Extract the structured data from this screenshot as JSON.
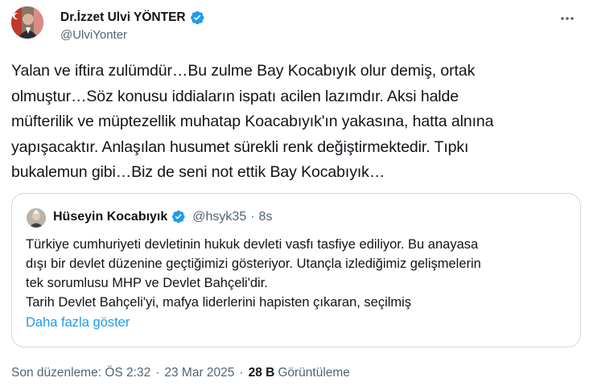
{
  "author": {
    "display_name": "Dr.İzzet Ulvi YÖNTER",
    "handle": "@UlviYonter",
    "verified": true,
    "avatar_icon": "avatar-photo"
  },
  "tweet": {
    "text": "Yalan ve iftira zulümdür…Bu zulme Bay Kocabıyık olur demiş, ortak\nolmuştur…Söz konusu iddiaların ispatı acilen lazımdır. Aksi halde\nmüfterilik ve müptezellik muhatap Koacabıyık'ın yakasına, hatta alnına\nyapışacaktır. Anlaşılan husumet sürekli renk değiştirmektedir. Tıpkı\nbukalemun gibi…Biz de seni not ettik Bay Kocabıyık…"
  },
  "quote": {
    "display_name": "Hüseyin Kocabıyık",
    "handle": "@hsyk35",
    "separator": "·",
    "time": "8s",
    "text": "Türkiye cumhuriyeti devletinin hukuk devleti vasfı tasfiye ediliyor. Bu anayasa\ndışı bir devlet düzenine geçtiğimizi gösteriyor. Utançla izlediğimiz gelişmelerin\ntek sorumlusu MHP ve Devlet Bahçeli'dir.\nTarih Devlet Bahçeli'yi, mafya liderlerini hapisten çıkaran, seçilmiş",
    "show_more": "Daha fazla göster"
  },
  "meta": {
    "edited_label": "Son düzenleme: ÖS 2:32",
    "separator": "·",
    "date": "23 Mar 2025",
    "views_count": "28 B",
    "views_label": "Görüntüleme"
  },
  "colors": {
    "verified": "#1d9bf0",
    "link": "#1d9bf0",
    "secondary_text": "#536471",
    "border": "#cfd9de"
  }
}
